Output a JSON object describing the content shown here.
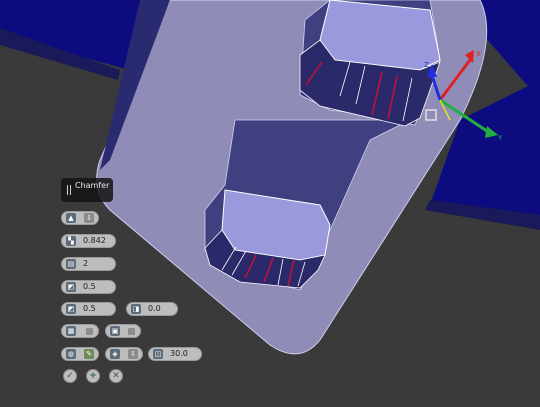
{
  "viewport": {
    "gizmo_axes": {
      "x": "X",
      "y": "Y",
      "z": "Z"
    }
  },
  "caddy": {
    "title": "Chamfer",
    "chamfer_size": "0.842",
    "segments": "2",
    "shape": "0.5",
    "depth": "0.5",
    "end_bias": "0.0",
    "angle": "30.0"
  },
  "icons": {
    "grip": "grip-icon",
    "mode": "chamfer-mode-icon",
    "ok": "ok-icon",
    "apply": "apply-and-continue-icon",
    "cancel": "cancel-icon"
  },
  "colors": {
    "background": "#3a3a3a",
    "mesh_face": "#8f8db8",
    "dark_mesh": "#0b0b7a",
    "selected_edge": "#d01030",
    "gizmo_x": "#e02020",
    "gizmo_y": "#20b040",
    "gizmo_z": "#2030e0"
  }
}
